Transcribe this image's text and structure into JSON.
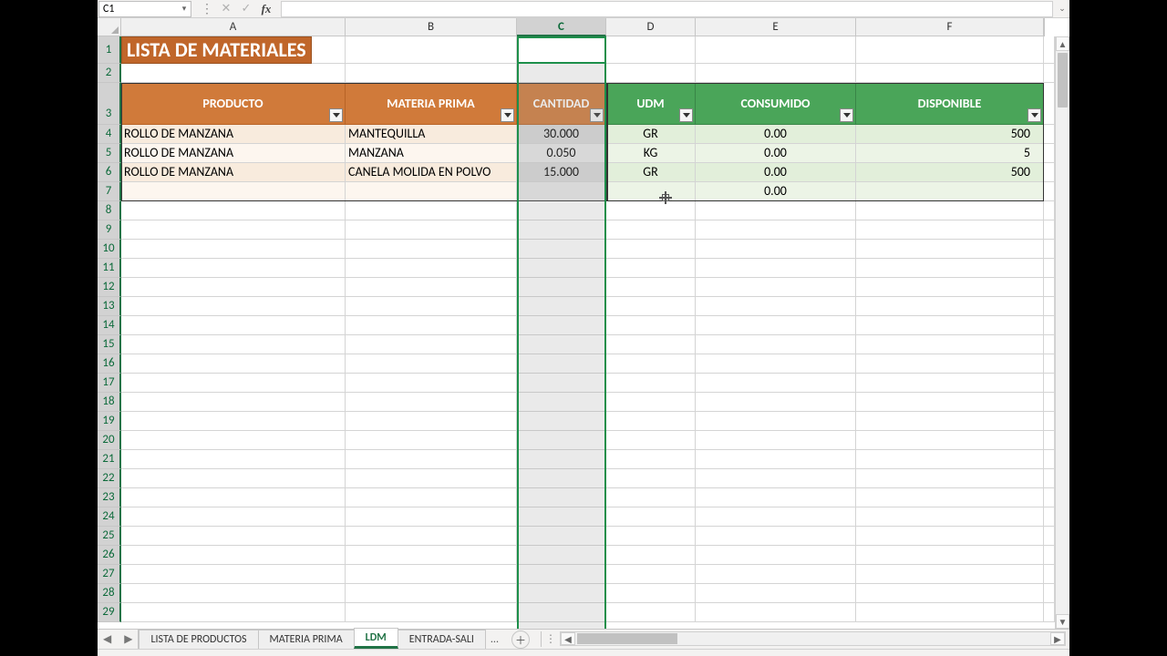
{
  "namebox": "C1",
  "columns": [
    "A",
    "B",
    "C",
    "D",
    "E",
    "F"
  ],
  "selected_column": "C",
  "title": "LISTA DE MATERIALES",
  "headers": {
    "producto": "PRODUCTO",
    "materia": "MATERIA PRIMA",
    "cantidad": "CANTIDAD",
    "udm": "UDM",
    "consumido": "CONSUMIDO",
    "disponible": "DISPONIBLE"
  },
  "rows": {
    "r4": {
      "producto": "ROLLO DE MANZANA",
      "materia": "MANTEQUILLA",
      "cantidad": "30.000",
      "udm": "GR",
      "consumido": "0.00",
      "disponible": "500"
    },
    "r5": {
      "producto": "ROLLO DE MANZANA",
      "materia": "MANZANA",
      "cantidad": "0.050",
      "udm": "KG",
      "consumido": "0.00",
      "disponible": "5"
    },
    "r6": {
      "producto": "ROLLO DE MANZANA",
      "materia": "CANELA MOLIDA EN POLVO",
      "cantidad": "15.000",
      "udm": "GR",
      "consumido": "0.00",
      "disponible": "500"
    },
    "r7": {
      "producto": "",
      "materia": "",
      "cantidad": "",
      "udm": "",
      "consumido": "0.00",
      "disponible": ""
    }
  },
  "row_numbers": [
    "1",
    "2",
    "3",
    "4",
    "5",
    "6",
    "7",
    "8",
    "9",
    "10",
    "11",
    "12",
    "13",
    "14",
    "15",
    "16",
    "17",
    "18",
    "19",
    "20",
    "21",
    "22",
    "23",
    "24",
    "25",
    "26",
    "27",
    "28",
    "29"
  ],
  "tabs": {
    "t1": "LISTA DE PRODUCTOS",
    "t2": "MATERIA PRIMA",
    "t3": "LDM",
    "t4": "ENTRADA-SALI",
    "ell": "..."
  },
  "chart_data": {
    "type": "table",
    "title": "LISTA DE MATERIALES",
    "columns": [
      "PRODUCTO",
      "MATERIA PRIMA",
      "CANTIDAD",
      "UDM",
      "CONSUMIDO",
      "DISPONIBLE"
    ],
    "rows": [
      [
        "ROLLO DE MANZANA",
        "MANTEQUILLA",
        30.0,
        "GR",
        0.0,
        500
      ],
      [
        "ROLLO DE MANZANA",
        "MANZANA",
        0.05,
        "KG",
        0.0,
        5
      ],
      [
        "ROLLO DE MANZANA",
        "CANELA MOLIDA EN POLVO",
        15.0,
        "GR",
        0.0,
        500
      ],
      [
        "",
        "",
        null,
        "",
        0.0,
        null
      ]
    ]
  }
}
